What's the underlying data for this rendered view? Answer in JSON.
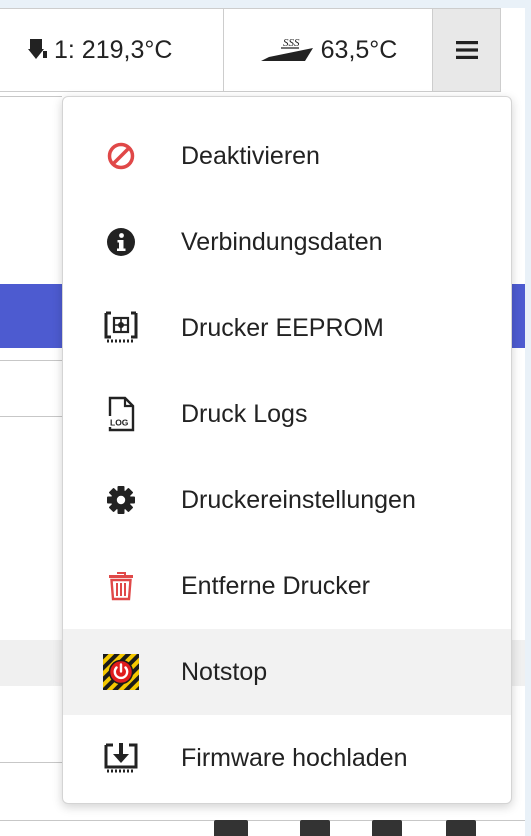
{
  "toolbar": {
    "extruder_label": "1: 219,3°C",
    "bed_label": "63,5°C",
    "bed_icon_text": "SSS"
  },
  "menu": {
    "items": [
      {
        "label": "Deaktivieren",
        "icon": "disable-icon"
      },
      {
        "label": "Verbindungsdaten",
        "icon": "info-icon"
      },
      {
        "label": "Drucker EEPROM",
        "icon": "eeprom-chip-icon"
      },
      {
        "label": "Druck Logs",
        "icon": "log-file-icon"
      },
      {
        "label": "Druckereinstellungen",
        "icon": "gear-icon"
      },
      {
        "label": "Entferne Drucker",
        "icon": "trash-icon"
      },
      {
        "label": "Notstop",
        "icon": "emergency-stop-icon"
      },
      {
        "label": "Firmware hochladen",
        "icon": "firmware-upload-icon"
      }
    ],
    "highlighted_item": "Notstop"
  },
  "colors": {
    "accent_band": "#4d5bd0",
    "danger": "#e04848",
    "hazard_yellow": "#f4c800",
    "highlight_row": "#f2f2f2"
  }
}
